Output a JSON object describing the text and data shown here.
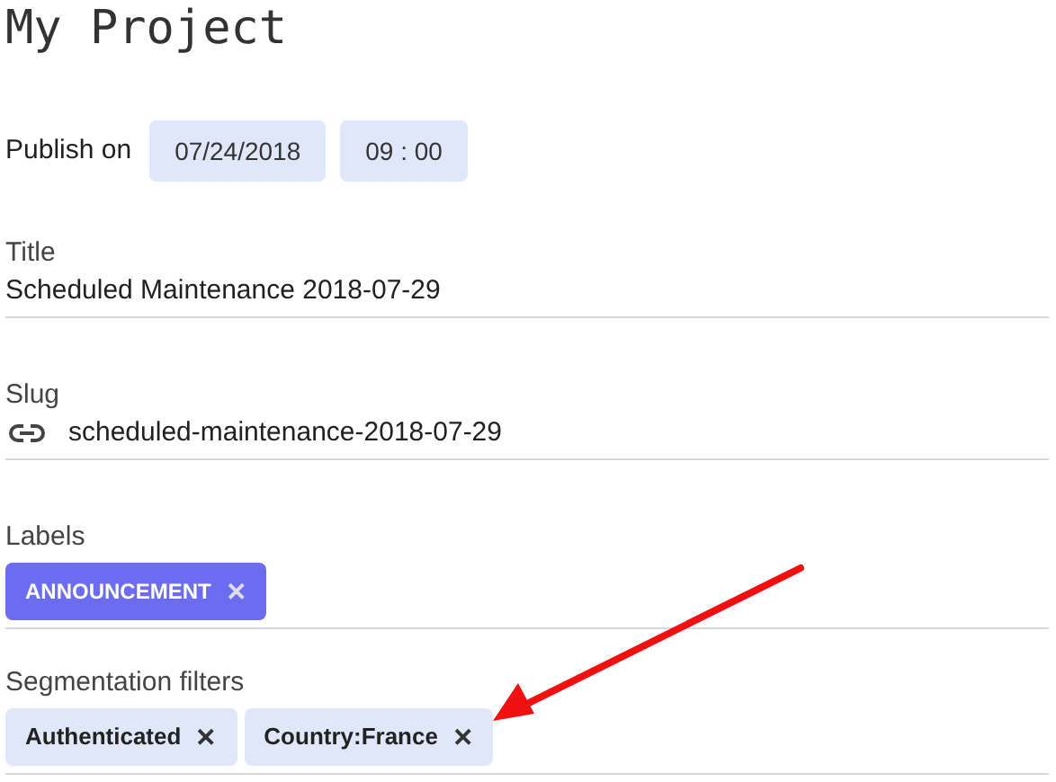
{
  "page": {
    "title": "My Project"
  },
  "publish": {
    "label": "Publish on",
    "date": "07/24/2018",
    "time": "09 : 00"
  },
  "title_field": {
    "label": "Title",
    "value": "Scheduled Maintenance 2018-07-29"
  },
  "slug_field": {
    "label": "Slug",
    "value": "scheduled-maintenance-2018-07-29"
  },
  "labels": {
    "label": "Labels",
    "chips": [
      {
        "text": "ANNOUNCEMENT",
        "remove": "✕"
      }
    ]
  },
  "segmentation_filters": {
    "label": "Segmentation filters",
    "chips": [
      {
        "text": "Authenticated",
        "remove": "✕"
      },
      {
        "text": "Country:France",
        "remove": "✕"
      }
    ]
  }
}
